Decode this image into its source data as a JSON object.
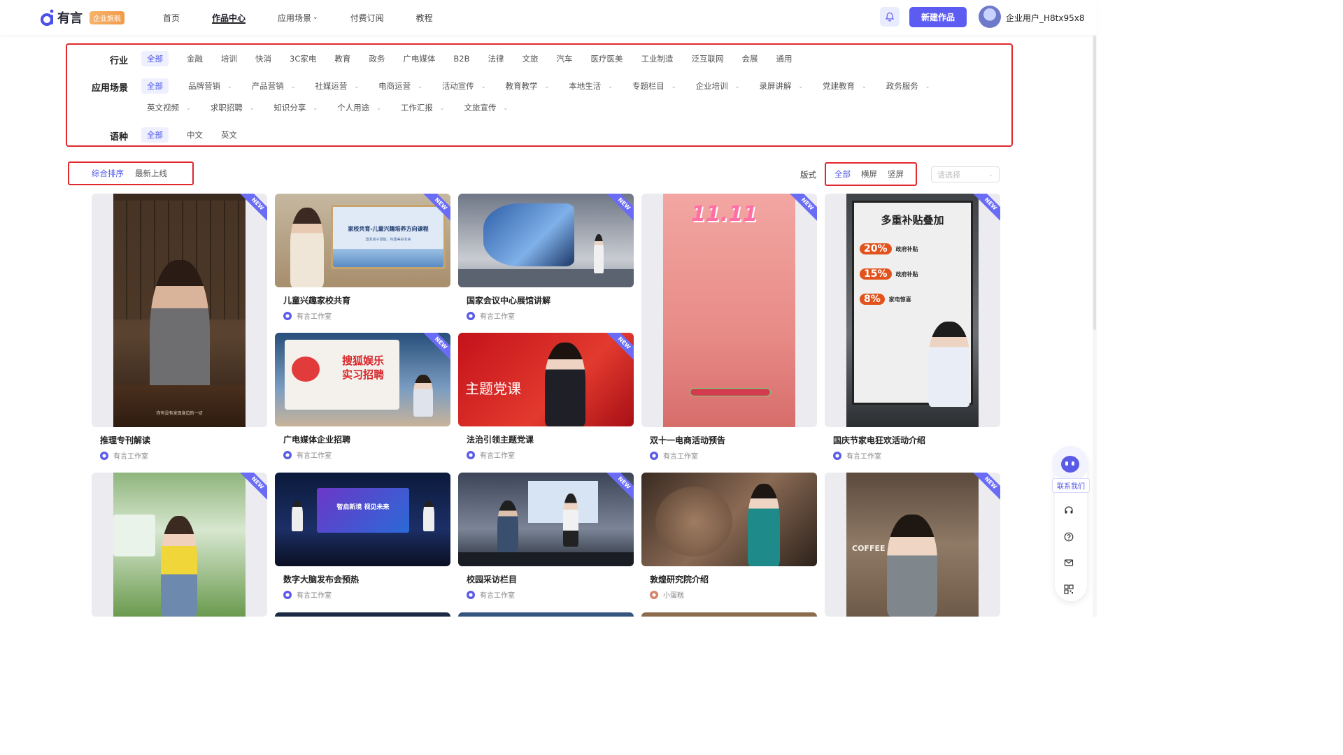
{
  "brand": {
    "name": "有言",
    "badge": "企业旗舰"
  },
  "nav": {
    "items": [
      {
        "label": "首页",
        "active": false
      },
      {
        "label": "作品中心",
        "active": true
      },
      {
        "label": "应用场景",
        "active": false,
        "has_dropdown": true
      },
      {
        "label": "付费订阅",
        "active": false
      },
      {
        "label": "教程",
        "active": false
      }
    ],
    "new_button": "新建作品",
    "username": "企业用户_H8tx95x8"
  },
  "filters": {
    "industry": {
      "label": "行业",
      "options": [
        "全部",
        "金融",
        "培训",
        "快消",
        "3C家电",
        "教育",
        "政务",
        "广电媒体",
        "B2B",
        "法律",
        "文旅",
        "汽车",
        "医疗医美",
        "工业制造",
        "泛互联网",
        "会展",
        "通用"
      ]
    },
    "scene": {
      "label": "应用场景",
      "row1": [
        "全部",
        "品牌营销",
        "产品营销",
        "社媒运营",
        "电商运营",
        "活动宣传",
        "教育教学",
        "本地生活",
        "专题栏目",
        "企业培训",
        "录屏讲解",
        "党建教育",
        "政务服务"
      ],
      "row2": [
        "英文视频",
        "求职招聘",
        "知识分享",
        "个人用途",
        "工作汇报",
        "文旅宣传"
      ]
    },
    "language": {
      "label": "语种",
      "options": [
        "全部",
        "中文",
        "英文"
      ]
    }
  },
  "sort": {
    "options": [
      "综合排序",
      "最新上线"
    ],
    "active": "综合排序"
  },
  "layout": {
    "label": "版式",
    "options": [
      "全部",
      "横屏",
      "竖屏"
    ],
    "active": "全部",
    "select_placeholder": "请选择"
  },
  "new_tag": "NEW",
  "cards": [
    {
      "title": "推理专刊解读",
      "author": "有言工作室",
      "new": true,
      "caption": "你有没有发现身边的一切"
    },
    {
      "title": "儿童兴趣家校共育",
      "author": "有言工作室",
      "new": true,
      "screen_title": "家校共育-儿童兴趣培养方向课程",
      "screen_sub": "激发孩子潜能，构建美好未来"
    },
    {
      "title": "国家会议中心展馆讲解",
      "author": "有言工作室",
      "new": true
    },
    {
      "title": "双十一电商活动预告",
      "author": "有言工作室",
      "new": true,
      "overlay": "11.11"
    },
    {
      "title": "国庆节家电狂欢活动介绍",
      "author": "有言工作室",
      "new": true,
      "poster_title": "多重补贴叠加",
      "poster_items": [
        {
          "pct": "20%",
          "text": "政府补贴"
        },
        {
          "pct": "15%",
          "text": "政府补贴"
        },
        {
          "pct": "8%",
          "text": "家电惊喜"
        }
      ]
    },
    {
      "title": "广电媒体企业招聘",
      "author": "有言工作室",
      "new": true,
      "poster_title": "搜狐娱乐 实习招聘"
    },
    {
      "title": "法治引领主题党课",
      "author": "有言工作室",
      "new": true,
      "poster_title": "主题党课"
    },
    {
      "title": "数字大脑发布会预热",
      "author": "有言工作室",
      "new": false,
      "screen_title": "智启新境 视见未来"
    },
    {
      "title": "校园采访栏目",
      "author": "有言工作室",
      "new": true
    },
    {
      "title": "敦煌研究院介绍",
      "author": "小蛋糕",
      "new": false
    },
    {
      "title": "",
      "author": "",
      "new": true,
      "overlay": "COFFEE"
    },
    {
      "title": "",
      "author": "",
      "new": true
    }
  ],
  "side_tools": {
    "contact": "联系我们"
  },
  "colors": {
    "accent": "#5d5cf2",
    "highlight_border": "#e0282e",
    "new_tag": "#6a6cf5"
  }
}
